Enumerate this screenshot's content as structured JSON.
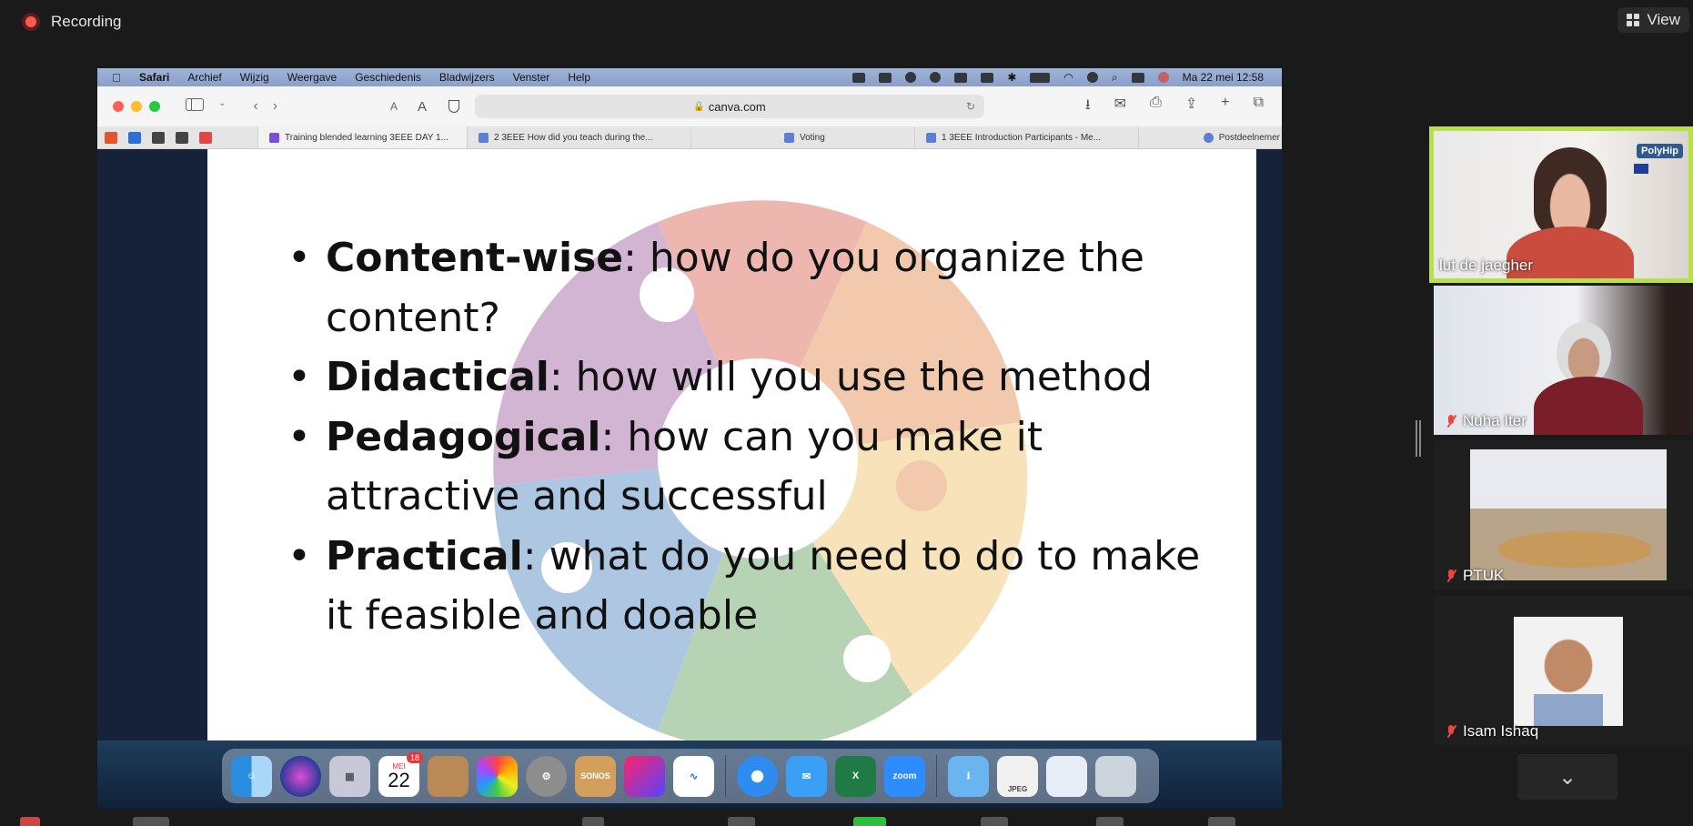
{
  "zoom": {
    "recording_label": "Recording",
    "view_label": "View"
  },
  "mac": {
    "app": "Safari",
    "menus": [
      "Archief",
      "Wijzig",
      "Weergave",
      "Geschiedenis",
      "Bladwijzers",
      "Venster",
      "Help"
    ],
    "clock": "Ma 22 mei  12:58"
  },
  "safari": {
    "url": "canva.com",
    "tabs": [
      {
        "label": "Training blended learning 3EEE DAY 1..."
      },
      {
        "label": "2 3EEE How did you teach during the..."
      },
      {
        "label": "Voting"
      },
      {
        "label": "1 3EEE Introduction Participants - Me..."
      },
      {
        "label": "Postdeelnemer"
      }
    ]
  },
  "slide": {
    "bullets": [
      {
        "term": "Content-wise",
        "text": ": how do you organize the content?"
      },
      {
        "term": "Didactical",
        "text": ": how will you use the method"
      },
      {
        "term": "Pedagogical",
        "text": ": how can you make it attractive and successful"
      },
      {
        "term": "Practical",
        "text": ": what do you need to do to make it feasible and doable"
      }
    ]
  },
  "dock": {
    "calendar_month": "MEI",
    "calendar_day": "22",
    "calendar_badge": "18",
    "sonos_label": "SONOS",
    "zoom_label": "zoom",
    "jpeg_label": "JPEG"
  },
  "participants": [
    {
      "name": "lut de jaegher",
      "logo": "PolyHip"
    },
    {
      "name": "Nuha Iter"
    },
    {
      "name": "PTUK"
    },
    {
      "name": "Isam Ishaq"
    }
  ],
  "colors": {
    "active_speaker_border": "#b7e04a",
    "mute_icon": "#e44444"
  }
}
